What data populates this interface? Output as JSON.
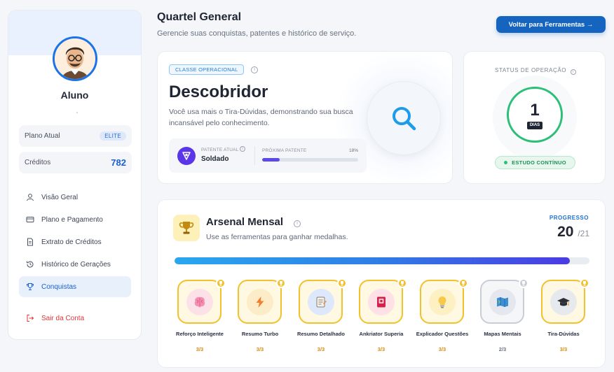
{
  "sidebar": {
    "username": "Aluno",
    "plan_label": "Plano Atual",
    "plan_badge": "ELITE",
    "credits_label": "Créditos",
    "credits_value": "782",
    "nav": [
      {
        "label": "Visão Geral",
        "icon": "user-icon"
      },
      {
        "label": "Plano e Pagamento",
        "icon": "credit-card-icon"
      },
      {
        "label": "Extrato de Créditos",
        "icon": "document-icon"
      },
      {
        "label": "Histórico de Gerações",
        "icon": "history-icon"
      },
      {
        "label": "Conquistas",
        "icon": "trophy-icon",
        "active": true
      }
    ],
    "logout_label": "Sair da Conta"
  },
  "header": {
    "title": "Quartel General",
    "subtitle": "Gerencie suas conquistas, patentes e histórico de serviço.",
    "back_button": "Voltar para Ferramentas →"
  },
  "class_card": {
    "tag": "CLASSE OPERACIONAL",
    "title": "Descobridor",
    "description": "Você usa mais o Tira-Dúvidas, demonstrando sua busca incansável pelo conhecimento.",
    "rank_label": "PATENTE ATUAL",
    "rank_value": "Soldado",
    "next_label": "PRÓXIMA PATENTE",
    "next_percent_text": "18%",
    "next_progress": 0.18
  },
  "status_card": {
    "title": "STATUS DE OPERAÇÃO",
    "days": "1",
    "days_label": "DIAS",
    "streak_label": "ESTUDO CONTÍNUO"
  },
  "arsenal": {
    "title": "Arsenal Mensal",
    "subtitle": "Use as ferramentas para ganhar medalhas.",
    "progress_label": "PROGRESSO",
    "progress_value": "20",
    "progress_total": "/21",
    "progress_fraction": 0.952,
    "medals": [
      {
        "name": "Reforço Inteligente",
        "count": "3/3",
        "icon": "brain-icon",
        "complete": true
      },
      {
        "name": "Resumo Turbo",
        "count": "3/3",
        "icon": "lightning-icon",
        "complete": true
      },
      {
        "name": "Resumo Detalhado",
        "count": "3/3",
        "icon": "notepad-icon",
        "complete": true
      },
      {
        "name": "Ankriator Superia",
        "count": "3/3",
        "icon": "cards-icon",
        "complete": true
      },
      {
        "name": "Explicador Questões",
        "count": "3/3",
        "icon": "lightbulb-icon",
        "complete": true
      },
      {
        "name": "Mapas Mentais",
        "count": "2/3",
        "icon": "map-icon",
        "complete": false
      },
      {
        "name": "Tira-Dúvidas",
        "count": "3/3",
        "icon": "graduation-cap-icon",
        "complete": true
      }
    ]
  },
  "colors": {
    "primary": "#1565c0",
    "accent_gold": "#f2c12e",
    "success_green": "#2bbf77",
    "rank_purple": "#5b35e8"
  }
}
